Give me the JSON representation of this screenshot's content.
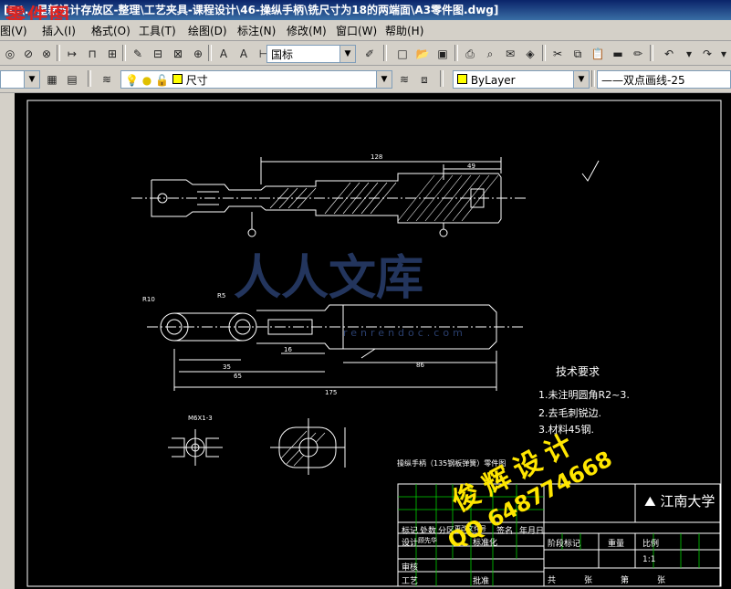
{
  "window": {
    "title": "[E:\\...星新设计存放区-整理\\工艺夹具-课程设计\\46-操纵手柄\\铣尺寸为18的两端面\\A3零件图.dwg]",
    "overlay_label": "零件图"
  },
  "menu": [
    {
      "label": "图(V)"
    },
    {
      "label": "插入(I)"
    },
    {
      "label": "格式(O)"
    },
    {
      "label": "工具(T)"
    },
    {
      "label": "绘图(D)"
    },
    {
      "label": "标注(N)"
    },
    {
      "label": "修改(M)"
    },
    {
      "label": "窗口(W)"
    },
    {
      "label": "帮助(H)"
    }
  ],
  "toolbar1": {
    "dimstyle": "国标"
  },
  "toolbar2": {
    "layer": "尺寸",
    "color": "ByLayer",
    "linetype": "——双点画线-25"
  },
  "drawing": {
    "dims": {
      "d128": "128",
      "d49": "49",
      "d175": "175",
      "d65": "65",
      "d86": "86",
      "d16": "16",
      "d35": "35",
      "r10": "R10",
      "r5": "R5",
      "m6": "M6X1-3"
    },
    "tech_title": "技术要求",
    "tech_items": [
      "1.未注明圆角R2~3.",
      "2.去毛刺锐边.",
      "3.材料45钢."
    ],
    "part_name": "操纵手柄（135钢板弹簧）零件图",
    "school": "江南大学",
    "table": {
      "row1": [
        "标记",
        "处数",
        "分区",
        "更改文件号",
        "签名",
        "年月日"
      ],
      "row2": [
        "设计",
        "顾先华",
        "",
        "标准化"
      ],
      "stage": [
        "阶段标记",
        "重量",
        "比例"
      ],
      "scale": "1:1",
      "row3": [
        "审核"
      ],
      "row4": [
        "工艺",
        "",
        "批准"
      ],
      "sheet": [
        "共",
        "张",
        "第",
        "张"
      ]
    }
  },
  "watermark": {
    "brand": "人人文库",
    "url": "renrendoc.com",
    "yellow1": "俊辉设计",
    "yellow2": "QQ 648774668"
  }
}
